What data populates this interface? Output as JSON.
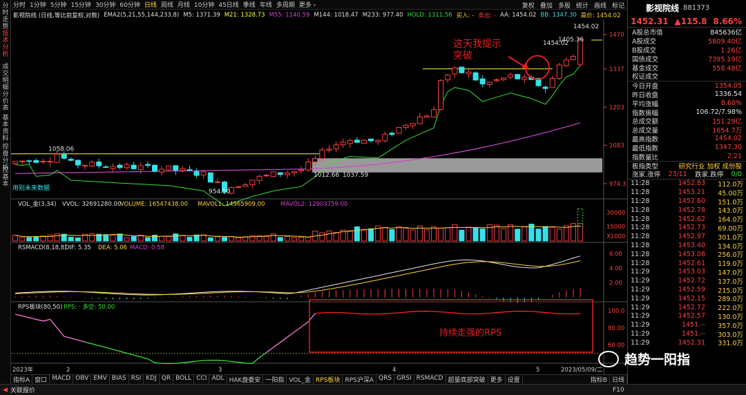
{
  "left_tabs": [
    {
      "label": "分时走势",
      "active": false
    },
    {
      "label": "技术分析",
      "active": true
    },
    {
      "label": "成交明细",
      "active": false
    },
    {
      "label": "分价表",
      "active": false
    },
    {
      "label": "基本资料",
      "active": false
    },
    {
      "label": "控盘分析",
      "active": false
    },
    {
      "label": "控基本",
      "active": false
    }
  ],
  "periods": [
    "分时",
    "1分钟",
    "5分钟",
    "15分钟",
    "30分钟",
    "60分钟",
    "日线",
    "周线",
    "月线",
    "10分钟",
    "45日线",
    "季线",
    "年线",
    "多周期",
    "更多 ›"
  ],
  "active_period": "日线",
  "toolbar": [
    "复权",
    "叠加",
    "多股",
    "统计",
    "画线",
    "标记"
  ],
  "indicator_line": {
    "name": "影视院线 (日线,等比前复权,对数)",
    "ema": "EMA2(5,21,55,144,233,8)",
    "m5": "M5: 1371.39",
    "m21": "M21: 1328.73",
    "m55": "M55: 1140.59",
    "m144": "M144: 1018.47",
    "m233": "M233: 977.40",
    "hold": "HOLD: 1311.56",
    "buy": "买入: -",
    "sell": "卖出: -",
    "aa": "AA: 1454.02",
    "bb": "BB: 1347.30",
    "high": "高价: 1454.02"
  },
  "price_axis": [
    "1470",
    "1337",
    "1203",
    "1083",
    "974.3"
  ],
  "price_labels": {
    "hi1": "1454.02",
    "hi2": "1454.02",
    "hi3": "1405.36",
    "l1058": "1058.06",
    "l954": "954.50",
    "l1012": "1012.66",
    "l1037": "1037.59",
    "future": "用别未来数据"
  },
  "annotation_top": "这天我提示\n突破",
  "annotation_rps": "持续走强的RPS",
  "vol_line": {
    "name": "VOL_金(3,34)",
    "vvol": "VVOL: 32691280.00",
    "volume": "VOLUME: 16547438.00",
    "mavol1": "MAVOL1: 14965909.00",
    "mavol2": "MAVOL2: 12903759.00"
  },
  "vol_axis": [
    "30000",
    "15000",
    "X1000"
  ],
  "macd_line": {
    "name": "RSMACD(8,18,8)",
    "dif": "DIF: 5.35",
    "dea": "DEA: 5.06",
    "macd": "MACD: 0.58"
  },
  "macd_axis": [
    "6.00",
    "4.00",
    "2.00"
  ],
  "rps_line": {
    "name": "RPS板块(80,50)",
    "rps": "RPS: · 多空: 50.00"
  },
  "rps_axis": [
    "100.0",
    "80.00",
    "60.00"
  ],
  "x_axis": [
    "2023年",
    "2",
    "3",
    "4",
    "5",
    "2023/05/09/二"
  ],
  "right_panel": {
    "name": "影视院线",
    "code": "881373",
    "price": "1452.31",
    "change": "▲115.8",
    "pct": "8.66%",
    "rows1": [
      {
        "l": "A股总市值",
        "v": "845636亿",
        "w": true
      },
      {
        "l": "A股成交",
        "v": "5809.40亿",
        "w": false
      },
      {
        "l": "B股成交",
        "v": "1.26亿",
        "w": false
      },
      {
        "l": "国债成交",
        "v": "7395.19亿",
        "w": false
      },
      {
        "l": "基金成交",
        "v": "558.48亿",
        "w": false
      },
      {
        "l": "权证成交",
        "v": "",
        "w": false
      }
    ],
    "rows2": [
      {
        "l": "今日开盘",
        "v": "1354.05",
        "w": false
      },
      {
        "l": "昨日收盘",
        "v": "1336.54",
        "w": true
      },
      {
        "l": "平均涨幅",
        "v": "8.60%",
        "w": false
      },
      {
        "l": "指数振幅",
        "v": "106.72/7.98%",
        "w": true
      },
      {
        "l": "总成交额",
        "v": "151.29亿",
        "w": false
      },
      {
        "l": "总成交量",
        "v": "1654.7万",
        "w": false
      },
      {
        "l": "最高指数",
        "v": "1454.02",
        "w": false
      },
      {
        "l": "最低指数",
        "v": "1347.30",
        "w": false
      },
      {
        "l": "指数量比",
        "v": "2.21",
        "w": false
      }
    ],
    "sector_label": "板指类型",
    "sector_value": "研究行业 加权 成份股",
    "updown": {
      "up_label": "涨家.涨停",
      "up": "23/11",
      "down_label": "跌家.跌停",
      "down": "0/0"
    },
    "ticks": [
      {
        "t": "11:28",
        "p": "1452.83",
        "q": "112.0万"
      },
      {
        "t": "11:28",
        "p": "1453.21",
        "q": "45.00万"
      },
      {
        "t": "11:28",
        "p": "1452.60",
        "q": "151.0万"
      },
      {
        "t": "11:28",
        "p": "1452.78",
        "q": "143.0万"
      },
      {
        "t": "11:28",
        "p": "1452.62",
        "q": "164.0万"
      },
      {
        "t": "11:28",
        "p": "1452.73",
        "q": "69.00万"
      },
      {
        "t": "11:28",
        "p": "1452.97",
        "q": "301.0万"
      },
      {
        "t": "11:28",
        "p": "1453.40",
        "q": "134.0万"
      },
      {
        "t": "11:28",
        "p": "1453.08",
        "q": "256.0万"
      },
      {
        "t": "11:28",
        "p": "1452.61",
        "q": "119.0万"
      },
      {
        "t": "11:29",
        "p": "1453.03",
        "q": "147.0万"
      },
      {
        "t": "11:29",
        "p": "1452.72",
        "q": "137.0万"
      },
      {
        "t": "11:29",
        "p": "1452.59",
        "q": "215.0万"
      },
      {
        "t": "11:29",
        "p": "1452.15",
        "q": "289.0万"
      },
      {
        "t": "11:29",
        "p": "1452.72",
        "q": "222.0万"
      },
      {
        "t": "11:29",
        "p": "1452.57",
        "q": "130.0万"
      },
      {
        "t": "11:29",
        "p": "1451.--",
        "q": "357.0万"
      },
      {
        "t": "11:29",
        "p": "1451.--",
        "q": "303.0万"
      },
      {
        "t": "11:29",
        "p": "1452.31",
        "q": "331.0万"
      }
    ]
  },
  "bottom_tabs": [
    "指标A",
    "窗口",
    "MACD",
    "OBV",
    "EMV",
    "BIAS",
    "RSI",
    "KDJ",
    "QR",
    "BOLL",
    "CCI",
    "ADL",
    "HAK盘委安",
    "一阳指",
    "VOL_金",
    "RPS板块",
    "RPS沪深A",
    "QRS",
    "GRSI",
    "RSMACD",
    "超量底部突破",
    "更多",
    "设置"
  ],
  "active_bottom": "RPS板块",
  "bottom_right": [
    "指标B",
    "日线"
  ],
  "status": {
    "left": "关联报价",
    "right": "F10"
  },
  "watermark": "趋势一阳指",
  "colors": {
    "up": "#ff4040",
    "down": "#36e0e8",
    "yellow": "#ffff40",
    "green": "#3adf3a",
    "magenta": "#d046d0",
    "annotation": "#e81f1f"
  }
}
